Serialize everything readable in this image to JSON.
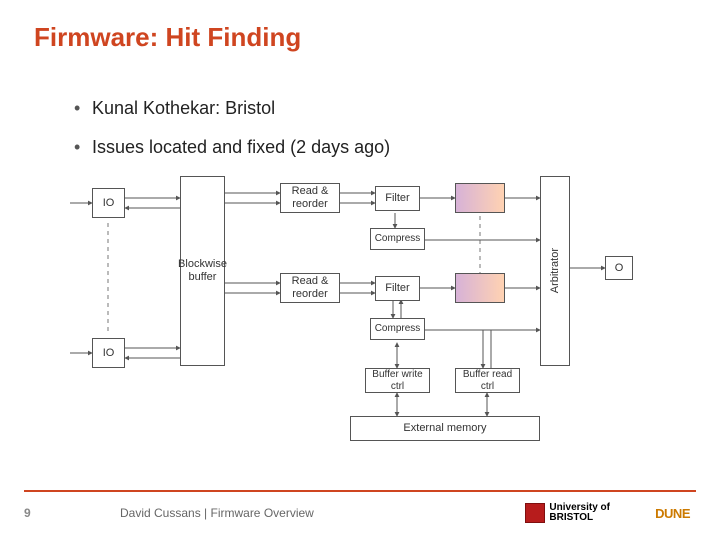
{
  "title": "Firmware: Hit Finding",
  "bullets": [
    "Kunal Kothekar: Bristol",
    "Issues located and fixed (2 days ago)"
  ],
  "diagram": {
    "io_top": "IO",
    "io_bottom": "IO",
    "blockwise_buffer": "Blockwise\nbuffer",
    "read_reorder_top": "Read &\nreorder",
    "read_reorder_bottom": "Read &\nreorder",
    "filter_top": "Filter",
    "filter_bottom": "Filter",
    "compress_top": "Compress",
    "compress_bottom": "Compress",
    "buffer_write": "Buffer\nwrite ctrl",
    "buffer_read": "Buffer\nread ctrl",
    "external_memory": "External memory",
    "arbitrator": "Arbitrator",
    "output": "O"
  },
  "footer": {
    "page": "9",
    "text": "David Cussans | Firmware Overview",
    "bristol": "University of\nBRISTOL",
    "dune": "DUNE"
  }
}
